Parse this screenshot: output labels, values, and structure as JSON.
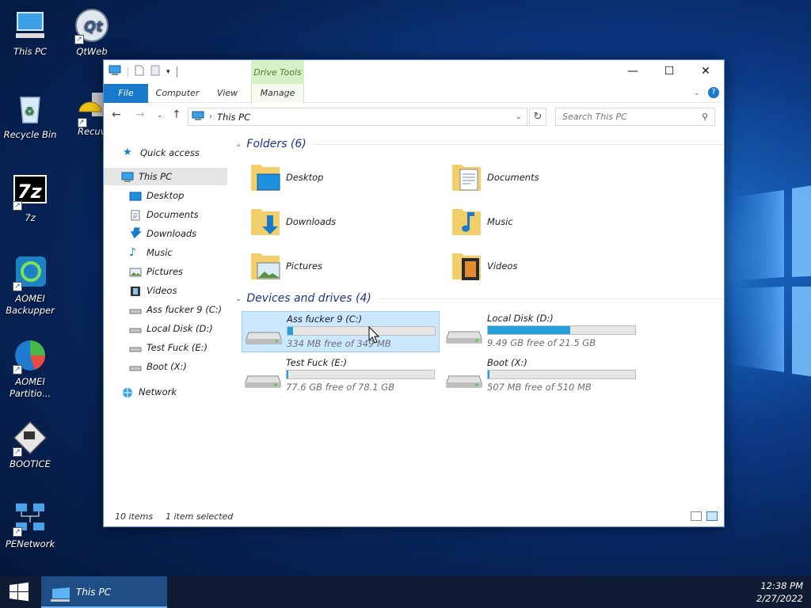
{
  "desktop": {
    "icons": [
      {
        "label": "This PC",
        "icon": "this-pc-icon"
      },
      {
        "label": "QtWeb",
        "icon": "qtweb-icon"
      },
      {
        "label": "Recycle Bin",
        "icon": "recycle-bin-icon"
      },
      {
        "label": "Recuv",
        "icon": "recuva-icon"
      },
      {
        "label": "7z",
        "icon": "7zip-icon"
      },
      {
        "label": "AOMEI Backupper",
        "icon": "aomei-backupper-icon"
      },
      {
        "label": "AOMEI Partitio...",
        "icon": "aomei-partition-icon"
      },
      {
        "label": "BOOTICE",
        "icon": "bootice-icon"
      },
      {
        "label": "PENetwork",
        "icon": "penetwork-icon"
      }
    ]
  },
  "window": {
    "title_tab": "Drive Tools",
    "ribbon_tabs": {
      "file": "File",
      "computer": "Computer",
      "view": "View",
      "manage": "Manage"
    },
    "address": "This PC",
    "search_placeholder": "Search This PC",
    "nav": [
      {
        "label": "Quick access",
        "icon": "star-icon"
      },
      {
        "label": "This PC",
        "icon": "this-pc-icon",
        "selected": true
      },
      {
        "label": "Desktop",
        "icon": "desktop-icon"
      },
      {
        "label": "Documents",
        "icon": "documents-icon"
      },
      {
        "label": "Downloads",
        "icon": "downloads-icon"
      },
      {
        "label": "Music",
        "icon": "music-icon"
      },
      {
        "label": "Pictures",
        "icon": "pictures-icon"
      },
      {
        "label": "Videos",
        "icon": "videos-icon"
      },
      {
        "label": "Ass fucker 9 (C:)",
        "icon": "drive-icon"
      },
      {
        "label": "Local Disk (D:)",
        "icon": "drive-icon"
      },
      {
        "label": "Test Fuck (E:)",
        "icon": "drive-icon"
      },
      {
        "label": "Boot (X:)",
        "icon": "drive-icon"
      },
      {
        "label": "Network",
        "icon": "network-icon"
      }
    ],
    "folders_header": "Folders (6)",
    "folders": [
      {
        "label": "Desktop",
        "icon": "desktop-folder-icon"
      },
      {
        "label": "Documents",
        "icon": "documents-folder-icon"
      },
      {
        "label": "Downloads",
        "icon": "downloads-folder-icon"
      },
      {
        "label": "Music",
        "icon": "music-folder-icon"
      },
      {
        "label": "Pictures",
        "icon": "pictures-folder-icon"
      },
      {
        "label": "Videos",
        "icon": "videos-folder-icon"
      }
    ],
    "drives_header": "Devices and drives (4)",
    "drives": [
      {
        "name": "Ass fucker 9 (C:)",
        "free": "334 MB free of 349 MB",
        "used_fraction": 0.04,
        "selected": true
      },
      {
        "name": "Local Disk (D:)",
        "free": "9.49 GB free of 21.5 GB",
        "used_fraction": 0.56,
        "selected": false
      },
      {
        "name": "Test Fuck (E:)",
        "free": "77.6 GB free of 78.1 GB",
        "used_fraction": 0.01,
        "selected": false
      },
      {
        "name": "Boot (X:)",
        "free": "507 MB free of 510 MB",
        "used_fraction": 0.01,
        "selected": false
      }
    ],
    "status": {
      "items": "10 items",
      "selected": "1 item selected"
    }
  },
  "taskbar": {
    "active_item": "This PC",
    "time": "12:38 PM",
    "date": "2/27/2022"
  },
  "colors": {
    "accent": "#1979ca",
    "drive_fill": "#26a0da",
    "selection": "#cce8ff"
  }
}
